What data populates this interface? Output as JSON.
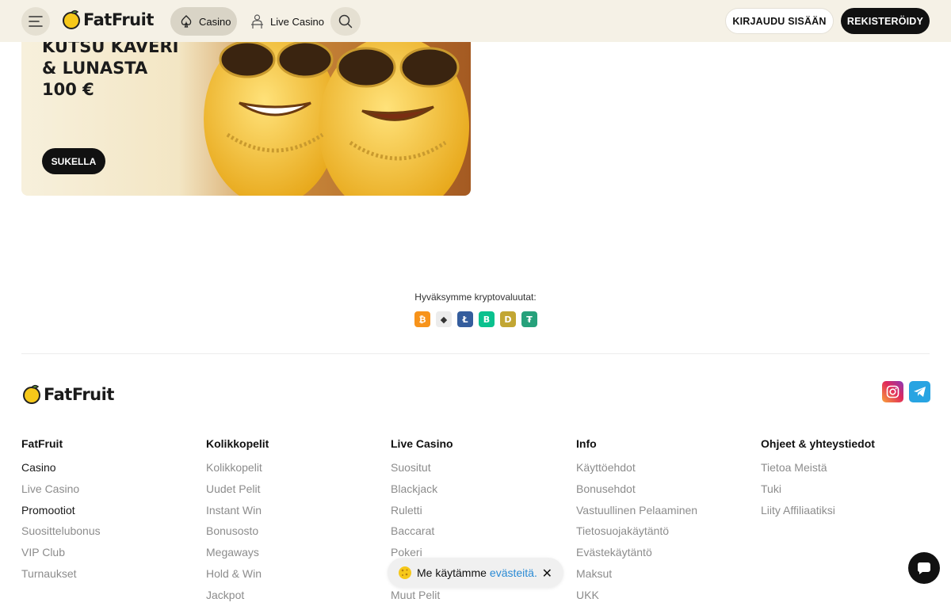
{
  "header": {
    "logo_text": "FatFruit",
    "nav": {
      "casino": "Casino",
      "live_casino": "Live Casino"
    },
    "login_label": "KIRJAUDU SISÄÄN",
    "register_label": "REKISTERÖIDY"
  },
  "promo": {
    "title_line1": "KUTSU KAVERI",
    "title_line2": "& LUNASTA",
    "title_line3": "100 €",
    "cta_label": "SUKELLA"
  },
  "crypto": {
    "label": "Hyväksymme kryptovaluutat:",
    "coins": [
      {
        "icon": "bitcoin-icon",
        "glyph": "₿",
        "color": "#f7931a"
      },
      {
        "icon": "ethereum-icon",
        "glyph": "◆",
        "color": "#ececec"
      },
      {
        "icon": "litecoin-icon",
        "glyph": "Ł",
        "color": "#345d9d"
      },
      {
        "icon": "bitcoin-cash-icon",
        "glyph": "B",
        "color": "#0ac18e"
      },
      {
        "icon": "dogecoin-icon",
        "glyph": "D",
        "color": "#c2a633"
      },
      {
        "icon": "tether-icon",
        "glyph": "₮",
        "color": "#26a17b"
      }
    ]
  },
  "footer": {
    "logo_text": "FatFruit",
    "columns": [
      {
        "title": "FatFruit",
        "links": [
          "Casino",
          "Live Casino",
          "Promootiot",
          "Suosittelubonus",
          "VIP Club",
          "Turnaukset"
        ]
      },
      {
        "title": "Kolikkopelit",
        "links": [
          "Kolikkopelit",
          "Uudet Pelit",
          "Instant Win",
          "Bonusosto",
          "Megaways",
          "Hold & Win",
          "Jackpot"
        ]
      },
      {
        "title": "Live Casino",
        "links": [
          "Suositut",
          "Blackjack",
          "Ruletti",
          "Baccarat",
          "Pokeri",
          "",
          "Muut Pelit"
        ]
      },
      {
        "title": "Info",
        "links": [
          "Käyttöehdot",
          "Bonusehdot",
          "Vastuullinen Pelaaminen",
          "Tietosuojakäytäntö",
          "Evästekäytäntö",
          "Maksut",
          "UKK"
        ]
      },
      {
        "title": "Ohjeet & yhteystiedot",
        "links": [
          "Tietoa Meistä",
          "Tuki",
          "Liity Affiliaatiksi"
        ]
      }
    ]
  },
  "cookie": {
    "text": "Me käytämme",
    "link": "evästeitä.",
    "close": "✕"
  }
}
